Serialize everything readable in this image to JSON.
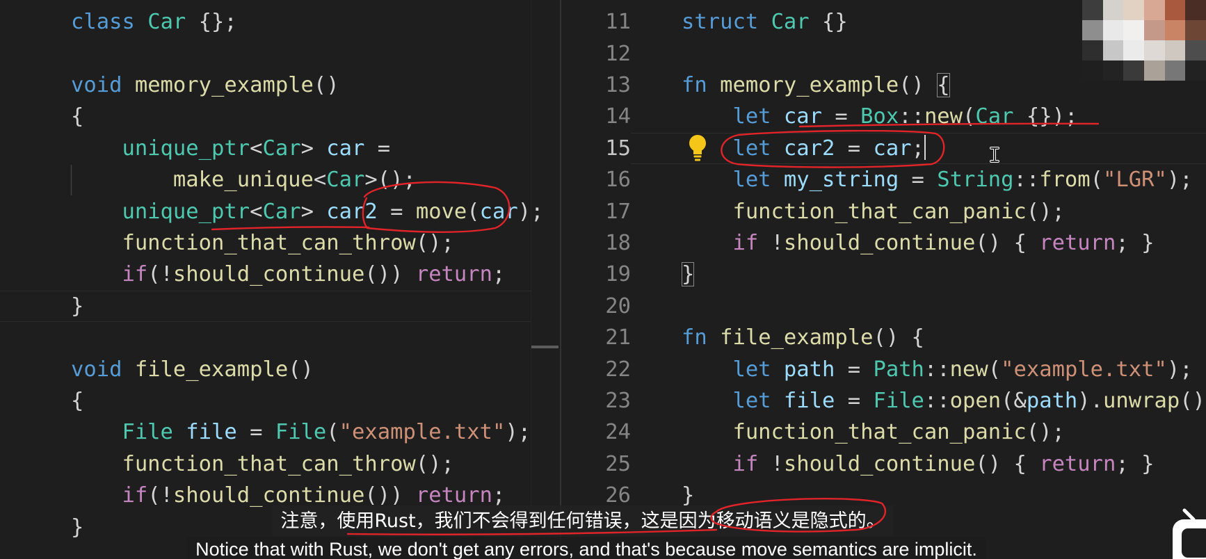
{
  "syntax_colors": {
    "kw": "#569cd6",
    "ctrl": "#c586c0",
    "type": "#4ec9b0",
    "fn": "#dcdcaa",
    "var": "#9cdcfe",
    "str": "#ce9178",
    "p": "#d4d4d4",
    "pm": "#d4d4d4"
  },
  "left_editor": {
    "lines": [
      {
        "tokens": [
          [
            "class",
            "kw"
          ],
          [
            " ",
            "p"
          ],
          [
            "Car",
            "type"
          ],
          [
            " {};",
            "p"
          ]
        ]
      },
      {
        "tokens": []
      },
      {
        "tokens": [
          [
            "void",
            "kw"
          ],
          [
            " ",
            "p"
          ],
          [
            "memory_example",
            "fn"
          ],
          [
            "()",
            "p"
          ]
        ]
      },
      {
        "tokens": [
          [
            "{",
            "p"
          ]
        ]
      },
      {
        "tokens": [
          [
            "    ",
            "p"
          ],
          [
            "unique_ptr",
            "type"
          ],
          [
            "<",
            "p"
          ],
          [
            "Car",
            "type"
          ],
          [
            "> ",
            "p"
          ],
          [
            "car",
            "var"
          ],
          [
            " =",
            "p"
          ]
        ]
      },
      {
        "tokens": [
          [
            "        ",
            "p"
          ],
          [
            "make_unique",
            "fn"
          ],
          [
            "<",
            "p"
          ],
          [
            "Car",
            "type"
          ],
          [
            ">();",
            "p"
          ]
        ]
      },
      {
        "tokens": [
          [
            "    ",
            "p"
          ],
          [
            "unique_ptr",
            "type"
          ],
          [
            "<",
            "p"
          ],
          [
            "Car",
            "type"
          ],
          [
            "> ",
            "p"
          ],
          [
            "car2",
            "var"
          ],
          [
            " = ",
            "p"
          ],
          [
            "move",
            "fn"
          ],
          [
            "(",
            "p"
          ],
          [
            "car",
            "var"
          ],
          [
            ");",
            "p"
          ]
        ]
      },
      {
        "tokens": [
          [
            "    ",
            "p"
          ],
          [
            "function_that_can_throw",
            "fn"
          ],
          [
            "();",
            "p"
          ]
        ]
      },
      {
        "tokens": [
          [
            "    ",
            "p"
          ],
          [
            "if",
            "ctrl"
          ],
          [
            "(!",
            "p"
          ],
          [
            "should_continue",
            "fn"
          ],
          [
            "()) ",
            "p"
          ],
          [
            "return",
            "ctrl"
          ],
          [
            ";",
            "p"
          ]
        ]
      },
      {
        "tokens": [
          [
            "}",
            "p"
          ]
        ],
        "highlighted": true
      },
      {
        "tokens": []
      },
      {
        "tokens": [
          [
            "void",
            "kw"
          ],
          [
            " ",
            "p"
          ],
          [
            "file_example",
            "fn"
          ],
          [
            "()",
            "p"
          ]
        ]
      },
      {
        "tokens": [
          [
            "{",
            "p"
          ]
        ]
      },
      {
        "tokens": [
          [
            "    ",
            "p"
          ],
          [
            "File",
            "type"
          ],
          [
            " ",
            "p"
          ],
          [
            "file",
            "var"
          ],
          [
            " = ",
            "p"
          ],
          [
            "File",
            "type"
          ],
          [
            "(",
            "p"
          ],
          [
            "\"example.txt\"",
            "str"
          ],
          [
            ");",
            "p"
          ]
        ]
      },
      {
        "tokens": [
          [
            "    ",
            "p"
          ],
          [
            "function_that_can_throw",
            "fn"
          ],
          [
            "();",
            "p"
          ]
        ]
      },
      {
        "tokens": [
          [
            "    ",
            "p"
          ],
          [
            "if",
            "ctrl"
          ],
          [
            "(!",
            "p"
          ],
          [
            "should_continue",
            "fn"
          ],
          [
            "()) ",
            "p"
          ],
          [
            "return",
            "ctrl"
          ],
          [
            ";",
            "p"
          ]
        ]
      },
      {
        "tokens": [
          [
            "}",
            "p"
          ]
        ]
      }
    ]
  },
  "right_editor": {
    "lines": [
      {
        "number": "11",
        "tokens": [
          [
            "struct",
            "kw"
          ],
          [
            " ",
            "p"
          ],
          [
            "Car",
            "type"
          ],
          [
            " {}",
            "p"
          ]
        ]
      },
      {
        "number": "12",
        "tokens": []
      },
      {
        "number": "13",
        "tokens": [
          [
            "fn",
            "kw"
          ],
          [
            " ",
            "p"
          ],
          [
            "memory_example",
            "fn"
          ],
          [
            "() ",
            "p"
          ],
          [
            "{",
            "pm"
          ]
        ]
      },
      {
        "number": "14",
        "tokens": [
          [
            "    ",
            "p"
          ],
          [
            "let",
            "kw"
          ],
          [
            " ",
            "p"
          ],
          [
            "car",
            "var"
          ],
          [
            " = ",
            "p"
          ],
          [
            "Box",
            "type"
          ],
          [
            "::",
            "p"
          ],
          [
            "new",
            "fn"
          ],
          [
            "(",
            "p"
          ],
          [
            "Car",
            "type"
          ],
          [
            " {});",
            "p"
          ]
        ]
      },
      {
        "number": "15",
        "active": true,
        "tokens": [
          [
            "    ",
            "p"
          ],
          [
            "let",
            "kw"
          ],
          [
            " ",
            "p"
          ],
          [
            "car2",
            "var"
          ],
          [
            " = ",
            "p"
          ],
          [
            "car",
            "var"
          ],
          [
            ";",
            "p"
          ]
        ]
      },
      {
        "number": "16",
        "tokens": [
          [
            "    ",
            "p"
          ],
          [
            "let",
            "kw"
          ],
          [
            " ",
            "p"
          ],
          [
            "my_string",
            "var"
          ],
          [
            " = ",
            "p"
          ],
          [
            "String",
            "type"
          ],
          [
            "::",
            "p"
          ],
          [
            "from",
            "fn"
          ],
          [
            "(",
            "p"
          ],
          [
            "\"LGR\"",
            "str"
          ],
          [
            ");",
            "p"
          ]
        ]
      },
      {
        "number": "17",
        "tokens": [
          [
            "    ",
            "p"
          ],
          [
            "function_that_can_panic",
            "fn"
          ],
          [
            "();",
            "p"
          ]
        ]
      },
      {
        "number": "18",
        "tokens": [
          [
            "    ",
            "p"
          ],
          [
            "if",
            "ctrl"
          ],
          [
            " !",
            "p"
          ],
          [
            "should_continue",
            "fn"
          ],
          [
            "() { ",
            "p"
          ],
          [
            "return",
            "ctrl"
          ],
          [
            "; }",
            "p"
          ]
        ]
      },
      {
        "number": "19",
        "tokens": [
          [
            "}",
            "pm"
          ]
        ]
      },
      {
        "number": "20",
        "tokens": []
      },
      {
        "number": "21",
        "tokens": [
          [
            "fn",
            "kw"
          ],
          [
            " ",
            "p"
          ],
          [
            "file_example",
            "fn"
          ],
          [
            "() {",
            "p"
          ]
        ]
      },
      {
        "number": "22",
        "tokens": [
          [
            "    ",
            "p"
          ],
          [
            "let",
            "kw"
          ],
          [
            " ",
            "p"
          ],
          [
            "path",
            "var"
          ],
          [
            " = ",
            "p"
          ],
          [
            "Path",
            "type"
          ],
          [
            "::",
            "p"
          ],
          [
            "new",
            "fn"
          ],
          [
            "(",
            "p"
          ],
          [
            "\"example.txt\"",
            "str"
          ],
          [
            ");",
            "p"
          ]
        ]
      },
      {
        "number": "23",
        "tokens": [
          [
            "    ",
            "p"
          ],
          [
            "let",
            "kw"
          ],
          [
            " ",
            "p"
          ],
          [
            "file",
            "var"
          ],
          [
            " = ",
            "p"
          ],
          [
            "File",
            "type"
          ],
          [
            "::",
            "p"
          ],
          [
            "open",
            "fn"
          ],
          [
            "(&",
            "p"
          ],
          [
            "path",
            "var"
          ],
          [
            ").",
            "p"
          ],
          [
            "unwrap",
            "fn"
          ],
          [
            "()",
            "p"
          ]
        ]
      },
      {
        "number": "24",
        "tokens": [
          [
            "    ",
            "p"
          ],
          [
            "function_that_can_panic",
            "fn"
          ],
          [
            "();",
            "p"
          ]
        ]
      },
      {
        "number": "25",
        "tokens": [
          [
            "    ",
            "p"
          ],
          [
            "if",
            "ctrl"
          ],
          [
            " !",
            "p"
          ],
          [
            "should_continue",
            "fn"
          ],
          [
            "() { ",
            "p"
          ],
          [
            "return",
            "ctrl"
          ],
          [
            "; }",
            "p"
          ]
        ]
      },
      {
        "number": "26",
        "tokens": [
          [
            "}",
            "p"
          ]
        ]
      }
    ]
  },
  "icons": {
    "code_action": "lightbulb-icon",
    "mouse_pointer": "ibeam-cursor-icon",
    "watermark": "watermark-logo-icon"
  },
  "annotation_color": "#e0242a",
  "subtitles": {
    "zh": "注意，使用Rust，我们不会得到任何错误，这是因为移动语义是隐式的。",
    "en": "Notice that with Rust, we don't get any errors, and that's because move semantics are implicit."
  }
}
